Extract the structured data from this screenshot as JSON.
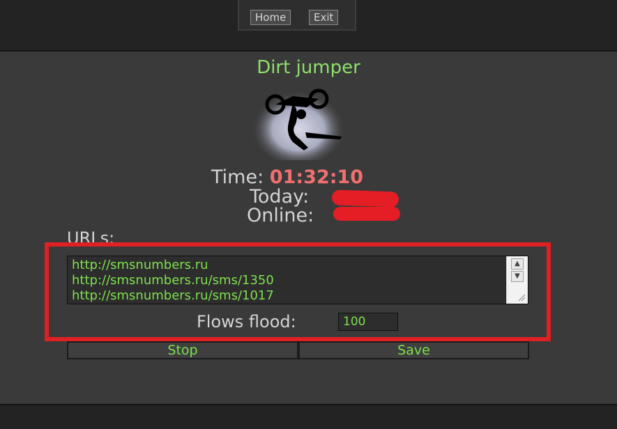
{
  "nav": {
    "home_label": "Home",
    "exit_label": "Exit"
  },
  "title": "Dirt jumper",
  "stats": {
    "time_label": "Time:",
    "time_value": "01:32:10",
    "today_label": "Today:",
    "online_label": "Online:"
  },
  "urls": {
    "label": "URLs:",
    "lines": [
      "http://smsnumbers.ru",
      "http://smsnumbers.ru/sms/1350",
      "http://smsnumbers.ru/sms/1017"
    ]
  },
  "flows": {
    "label": "Flows flood:",
    "value": "100"
  },
  "actions": {
    "stop_label": "Stop",
    "save_label": "Save"
  },
  "colors": {
    "accent_green": "#7fe04e",
    "time_red": "#f07070",
    "highlight_red": "#e02124",
    "redaction_red": "#e51d24"
  },
  "icons": {
    "logo": "motorbike-rider-logo",
    "scroll_up": "scroll-up-arrow-icon",
    "scroll_down": "scroll-down-arrow-icon",
    "resize": "resize-grip-icon"
  }
}
